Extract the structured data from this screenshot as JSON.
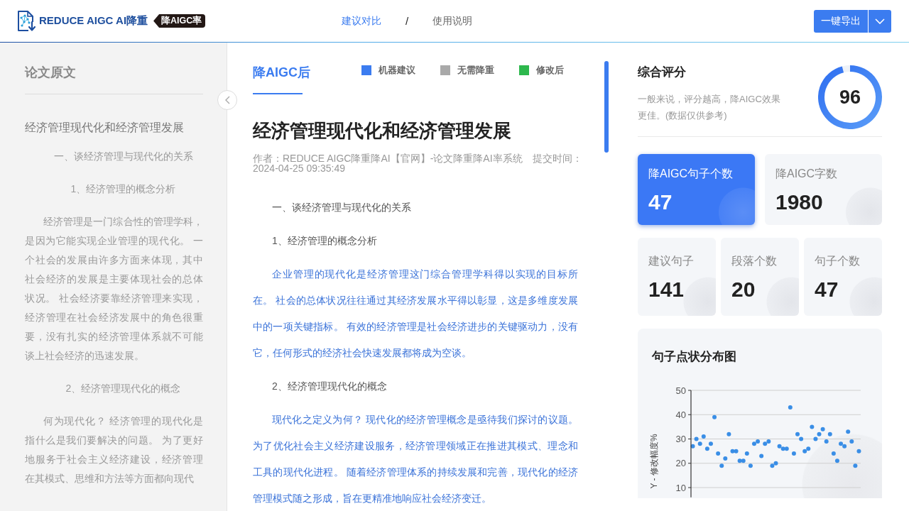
{
  "header": {
    "logo_text": "REDUCE AIGC AI降重",
    "badge": "降AIGC率",
    "nav": [
      {
        "label": "建议对比",
        "selected": true
      },
      {
        "label": "使用说明",
        "selected": false
      }
    ],
    "nav_separator": "/",
    "export_button": "一键导出"
  },
  "original_panel": {
    "title": "论文原文",
    "paragraphs": [
      {
        "kind": "title",
        "text": "经济管理现代化和经济管理发展"
      },
      {
        "kind": "heading",
        "text": "一、谈经济管理与现代化的关系"
      },
      {
        "kind": "heading",
        "text": "1、经济管理的概念分析"
      },
      {
        "kind": "body",
        "text": "经济管理是一门综合性的管理学科，是因为它能实现企业管理的现代化。 一个社会的发展由许多方面来体现，其中社会经济的发展是主要体现社会的总体状况。 社会经济要靠经济管理来实现，经济管理在社会经济发展中的角色很重要，没有扎实的经济管理体系就不可能谈上社会经济的迅速发展。"
      },
      {
        "kind": "heading",
        "text": "2、经济管理现代化的概念"
      },
      {
        "kind": "body",
        "text": "何为现代化？ 经济管理的现代化是指什么是我们要解决的问题。 为了更好地服务于社会主义经济建设，经济管理在其模式、思维和方法等方面都向现代"
      }
    ]
  },
  "result_panel": {
    "tabs": [
      {
        "label": "降AIGC后",
        "selected": true
      }
    ],
    "legend": [
      {
        "label": "机器建议",
        "color": "#3b7cf0"
      },
      {
        "label": "无需降重",
        "color": "#a9a9a9"
      },
      {
        "label": "修改后",
        "color": "#2db84d"
      }
    ],
    "title": "经济管理现代化和经济管理发展",
    "meta": "作者：REDUCE AIGC降重降AI【官网】-论文降重降AI率系统　提交时间：2024-04-25 09:35:49",
    "paragraphs": [
      {
        "kind": "heading",
        "text": "一、谈经济管理与现代化的关系"
      },
      {
        "kind": "heading",
        "text": "1、经济管理的概念分析"
      },
      {
        "kind": "suggestion",
        "text": "企业管理的现代化是经济管理这门综合管理学科得以实现的目标所在。 社会的总体状况往往通过其经济发展水平得以彰显，这是多维度发展中的一项关键指标。 有效的经济管理是社会经济进步的关键驱动力，没有它，任何形式的经济社会快速发展都将成为空谈。"
      },
      {
        "kind": "heading",
        "text": "2、经济管理现代化的概念"
      },
      {
        "kind": "suggestion",
        "text": "现代化之定义为何？ 现代化的经济管理概念是亟待我们探讨的议题。为了优化社会主义经济建设服务，经济管理领域正在推进其模式、理念和工具的现代化进程。 随着经济管理体系的持续发展和完善，现代化的经济管理模式随之形成，旨在更精准地响应社会经济变迁。"
      }
    ]
  },
  "score_panel": {
    "title": "综合评分",
    "description": "一般来说，评分越高，降AIGC效果更佳。(数据仅供参考)",
    "score": "96",
    "level": 0.96
  },
  "stat_rows": [
    {
      "cards": [
        {
          "label": "降AIGC句子个数",
          "value": "47",
          "selected": true
        },
        {
          "label": "降AIGC字数",
          "value": "1980",
          "selected": false
        }
      ]
    },
    {
      "cards": [
        {
          "label": "建议句子",
          "value": "141",
          "selected": false
        },
        {
          "label": "段落个数",
          "value": "20",
          "selected": false
        },
        {
          "label": "句子个数",
          "value": "47",
          "selected": false
        }
      ]
    }
  ],
  "chart_card": {
    "chart_data": {
      "type": "scatter",
      "title": "句子点状分布图",
      "ylabel": "Y - 修改幅度%",
      "ylim": [
        6,
        50
      ],
      "yticks": [
        10,
        20,
        30,
        40,
        50
      ],
      "grid": true,
      "categories": [
        null,
        null,
        null,
        null,
        null,
        null,
        null,
        null,
        null,
        null,
        null,
        null,
        null,
        null,
        null,
        null,
        null,
        null,
        null,
        null,
        null,
        null,
        null,
        null,
        null,
        null,
        null,
        null,
        null,
        null,
        null,
        null,
        null,
        null,
        null,
        null,
        null,
        null,
        null,
        null,
        null,
        null,
        null,
        null,
        null,
        null,
        null
      ],
      "series": [
        {
          "color": "#3a8ee6",
          "values": [
            27,
            30,
            28,
            31,
            26,
            28,
            39,
            24,
            19,
            22,
            32,
            25,
            25,
            21,
            21,
            24,
            19,
            28,
            29,
            23,
            28,
            29,
            19,
            20,
            27,
            26,
            26,
            43,
            24,
            32,
            30,
            25,
            26,
            35,
            30,
            32,
            34,
            29,
            32,
            24,
            21,
            28,
            27,
            33,
            29,
            19,
            25
          ]
        }
      ]
    }
  }
}
